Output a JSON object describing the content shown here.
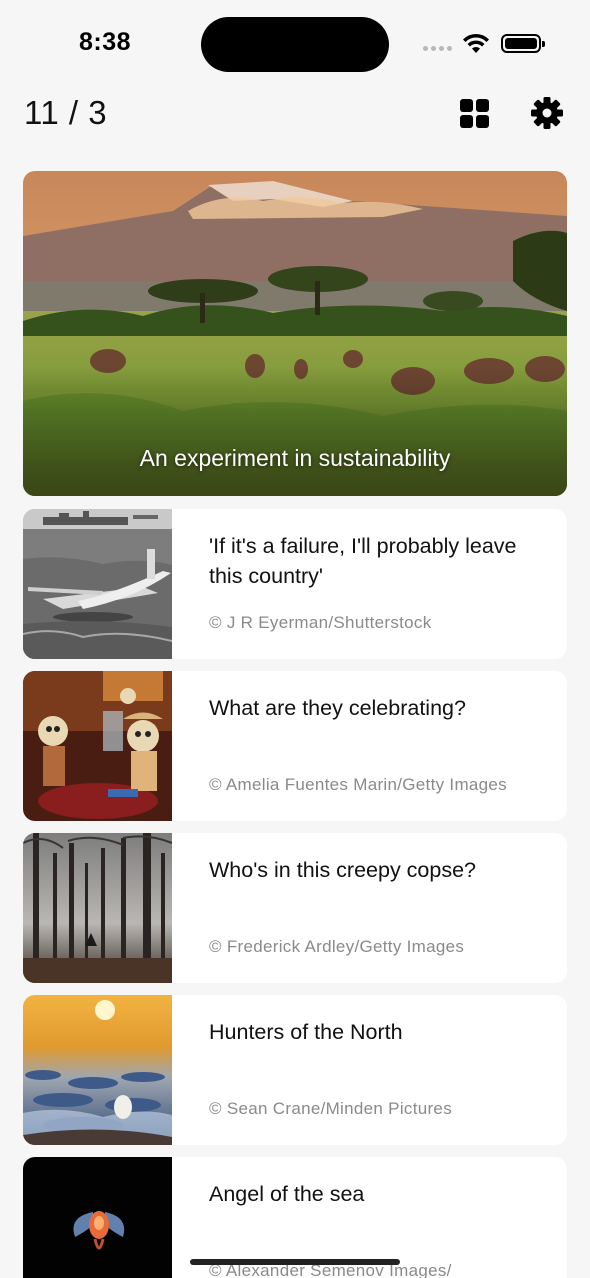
{
  "status_bar": {
    "time": "8:38"
  },
  "header": {
    "page_counter": "11 / 3"
  },
  "hero": {
    "caption": "An experiment in sustainability"
  },
  "stories": [
    {
      "title": "'If it's a failure, I'll probably leave this country'",
      "credit": "© J R Eyerman/Shutterstock"
    },
    {
      "title": "What are they celebrating?",
      "credit": "© Amelia Fuentes Marin/Getty Images"
    },
    {
      "title": "Who's in this creepy copse?",
      "credit": "© Frederick Ardley/Getty Images"
    },
    {
      "title": "Hunters of the North",
      "credit": "© Sean Crane/Minden Pictures"
    },
    {
      "title": "Angel of the sea",
      "credit": "© Alexander Semenov Images/ Shutterstock"
    }
  ],
  "icons": {
    "grid": "grid-icon",
    "settings": "gear-icon",
    "wifi": "wifi-icon",
    "battery": "battery-icon"
  }
}
